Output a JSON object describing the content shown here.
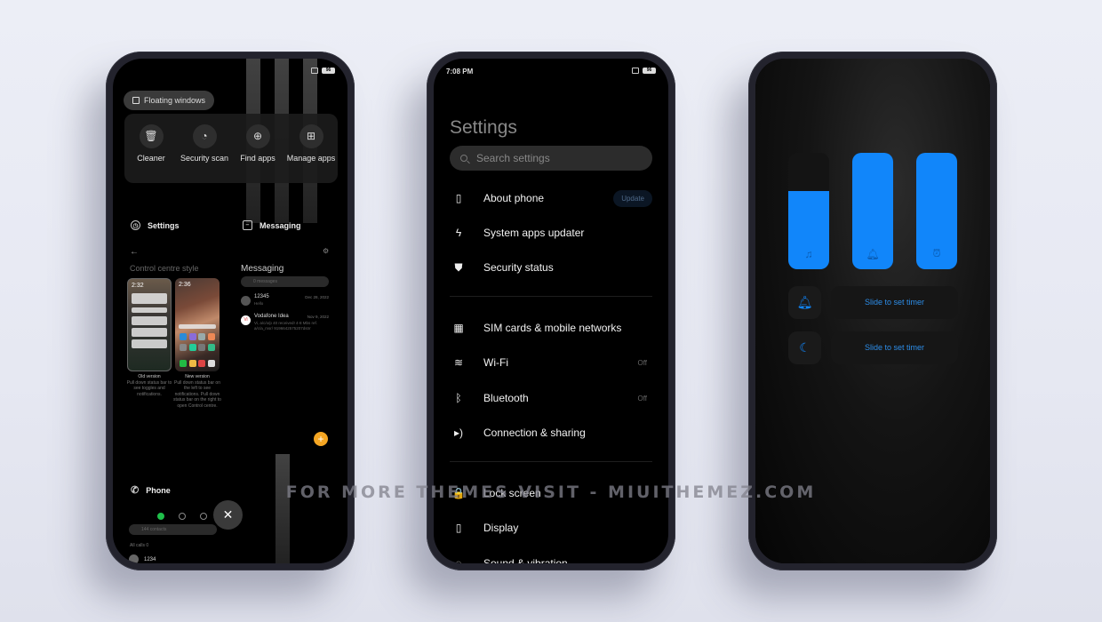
{
  "watermark": "FOR MORE THEMES VISIT - MIUITHEMEZ.COM",
  "left_phone": {
    "status": {
      "battery": "96"
    },
    "floating_windows": "Floating windows",
    "quick_actions": [
      {
        "label": "Cleaner",
        "icon": "trash-icon"
      },
      {
        "label": "Security scan",
        "icon": "speedometer-icon"
      },
      {
        "label": "Find apps",
        "icon": "app-search-icon"
      },
      {
        "label": "Manage apps",
        "icon": "grid-icon"
      }
    ],
    "settings_card": {
      "title": "Settings",
      "subtitle": "Control centre style",
      "old_version": {
        "time": "2:32",
        "title": "Old version",
        "desc": "Pull down status bar to see toggles and notifications."
      },
      "new_version": {
        "time": "2:36",
        "title": "New version",
        "desc": "Pull down status bar on the left to see notifications. Pull down status bar on the right to open Control centre."
      }
    },
    "messaging_card": {
      "title": "Messaging",
      "header": "Messaging",
      "search_placeholder": "0 messages",
      "messages": [
        {
          "name": "12345",
          "preview": "Hello",
          "date": "Dec 28, 2022"
        },
        {
          "name": "Vodafone Idea",
          "preview": "Vi, a/c/o/p 40 received! 4-8 Mbs ref. a/c/a_msr/ 9196642575207dstrr",
          "date": "Nov 9, 2022"
        }
      ]
    },
    "phone_card": {
      "title": "Phone",
      "search_placeholder": "144 contacts",
      "calls_label": "All calls  0",
      "call_entry": "1234"
    }
  },
  "mid_phone": {
    "status": {
      "time": "7:08 PM",
      "battery": "96"
    },
    "title": "Settings",
    "search_placeholder": "Search settings",
    "group1": [
      {
        "label": "About phone",
        "icon": "phone-icon",
        "badge": "Update"
      },
      {
        "label": "System apps updater",
        "icon": "bolt-icon"
      },
      {
        "label": "Security status",
        "icon": "shield-icon"
      }
    ],
    "group2": [
      {
        "label": "SIM cards & mobile networks",
        "icon": "sim-icon"
      },
      {
        "label": "Wi-Fi",
        "icon": "wifi-icon",
        "value": "Off"
      },
      {
        "label": "Bluetooth",
        "icon": "bluetooth-icon",
        "value": "Off"
      },
      {
        "label": "Connection & sharing",
        "icon": "connection-icon"
      }
    ],
    "group3": [
      {
        "label": "Lock screen",
        "icon": "lock-icon"
      },
      {
        "label": "Display",
        "icon": "display-icon"
      },
      {
        "label": "Sound & vibration",
        "icon": "sound-icon"
      }
    ]
  },
  "right_phone": {
    "accent": "#1186fa",
    "sliders": [
      {
        "name": "media-volume",
        "icon": "music-note-icon",
        "level": 0.67
      },
      {
        "name": "ring-volume",
        "icon": "bell-icon",
        "level": 1.0
      },
      {
        "name": "alarm-volume",
        "icon": "alarm-clock-icon",
        "level": 1.0
      }
    ],
    "timers": [
      {
        "icon": "bell-icon",
        "label": "Slide to set timer"
      },
      {
        "icon": "moon-icon",
        "label": "Slide to set timer"
      }
    ]
  }
}
